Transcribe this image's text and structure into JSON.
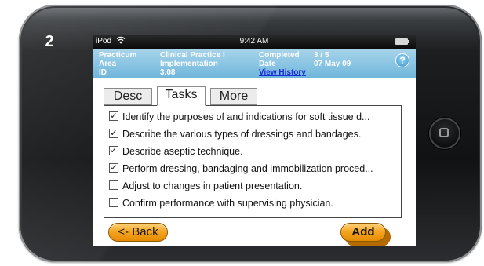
{
  "step_number": "2",
  "status_bar": {
    "device": "iPod",
    "wifi_icon": "wifi-icon",
    "time": "9:42 AM",
    "battery_icon": "battery-icon"
  },
  "info": {
    "practicum_label_1": "Practicum",
    "practicum_label_2": "Area",
    "practicum_label_3": "ID",
    "area_value_1": "Clinical Practice I",
    "area_value_2": "Implementation",
    "area_value_3": "3.08",
    "completed_label": "Completed",
    "date_label": "Date",
    "completed_value": "3 / 5",
    "date_value": "07 May 09",
    "history_link": "View History",
    "help_symbol": "?"
  },
  "tabs": [
    {
      "label": "Desc"
    },
    {
      "label": "Tasks"
    },
    {
      "label": "More"
    }
  ],
  "tasks": [
    {
      "checked": true,
      "text": "Identify the purposes of and indications for soft tissue d..."
    },
    {
      "checked": true,
      "text": "Describe the various types of dressings and bandages."
    },
    {
      "checked": true,
      "text": "Describe aseptic technique."
    },
    {
      "checked": true,
      "text": "Perform dressing, bandaging and immobilization proced..."
    },
    {
      "checked": false,
      "text": "Adjust to changes in patient presentation."
    },
    {
      "checked": false,
      "text": "Confirm performance with supervising physician."
    }
  ],
  "buttons": {
    "back": "<- Back",
    "add": "Add"
  },
  "colors": {
    "info_bar": "#7fc0e2",
    "button": "#f5a623",
    "link": "#1a2ad8"
  }
}
